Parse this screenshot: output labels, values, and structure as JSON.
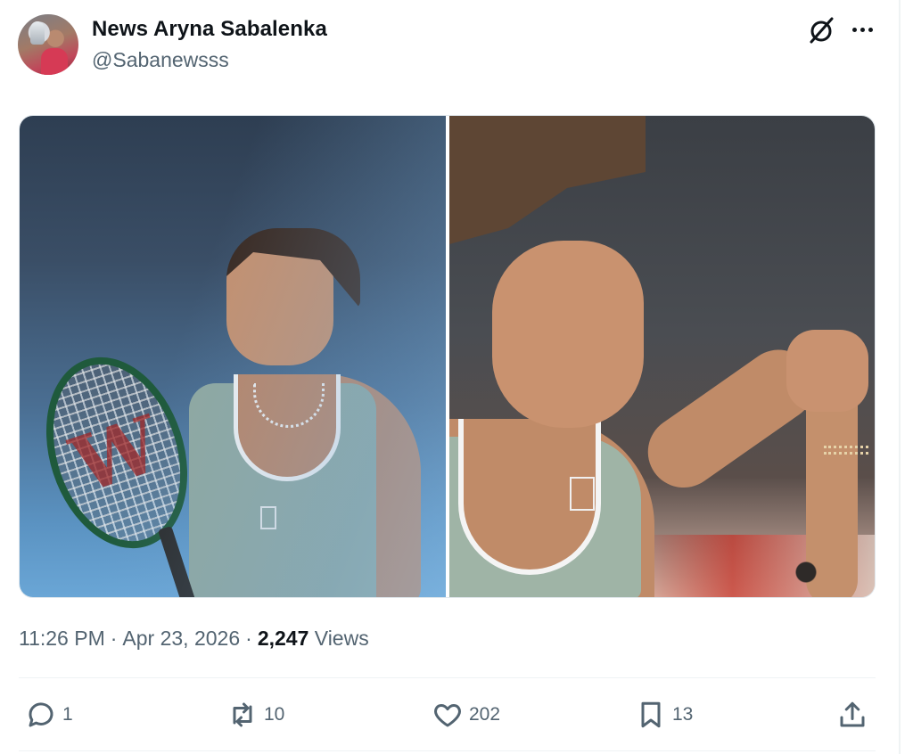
{
  "author": {
    "display_name": "News Aryna Sabalenka",
    "handle": "@Sabanewsss"
  },
  "header_icons": [
    "grok-icon",
    "more-icon"
  ],
  "media": {
    "count": 2,
    "items": [
      {
        "name": "photo-racket"
      },
      {
        "name": "photo-fist-pump"
      }
    ]
  },
  "meta": {
    "time": "11:26 PM",
    "separator": "·",
    "date": "Apr 23, 2026",
    "views_count": "2,247",
    "views_label": "Views"
  },
  "actions": {
    "reply": {
      "icon": "reply-icon",
      "count": "1"
    },
    "repost": {
      "icon": "repost-icon",
      "count": "10"
    },
    "like": {
      "icon": "heart-icon",
      "count": "202"
    },
    "bookmark": {
      "icon": "bookmark-icon",
      "count": "13"
    },
    "share": {
      "icon": "share-icon"
    }
  },
  "colors": {
    "text_primary": "#0f1419",
    "text_secondary": "#536471",
    "border": "#eff3f4"
  }
}
